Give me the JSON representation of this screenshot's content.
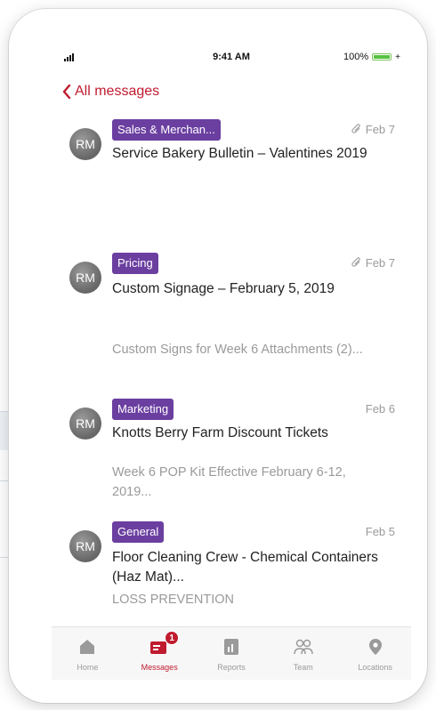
{
  "status_bar": {
    "time": "9:41 AM",
    "battery": "100%",
    "charging": "+"
  },
  "nav": {
    "back_label": "All messages"
  },
  "messages": [
    {
      "avatar": "RM",
      "tag": "Sales & Merchan...",
      "date": "Feb 7",
      "attachment": true,
      "title": "Service Bakery Bulletin – Valentines 2019",
      "preview": ""
    },
    {
      "avatar": "RM",
      "tag": "Pricing",
      "date": "Feb 7",
      "attachment": true,
      "title": "Custom Signage – February 5, 2019",
      "preview": "Custom Signs for Week 6 Attachments (2)..."
    },
    {
      "avatar": "RM",
      "tag": "Marketing",
      "date": "Feb 6",
      "attachment": false,
      "title": "Knotts Berry Farm Discount Tickets",
      "preview": "Week 6 POP Kit Effective February 6-12, 2019..."
    },
    {
      "avatar": "RM",
      "tag": "General",
      "date": "Feb 5",
      "attachment": false,
      "title": "Floor Cleaning Crew - Chemical Containers (Haz Mat)...",
      "preview": "LOSS PREVENTION"
    }
  ],
  "tabs": [
    {
      "label": "Home",
      "icon": "home-icon"
    },
    {
      "label": "Messages",
      "icon": "messages-icon",
      "badge": "1",
      "active": true
    },
    {
      "label": "Reports",
      "icon": "reports-icon"
    },
    {
      "label": "Team",
      "icon": "team-icon"
    },
    {
      "label": "Locations",
      "icon": "location-pin-icon"
    }
  ],
  "colors": {
    "accent": "#c01b2f",
    "tag": "#6b3fa0",
    "battery": "#56c140"
  }
}
